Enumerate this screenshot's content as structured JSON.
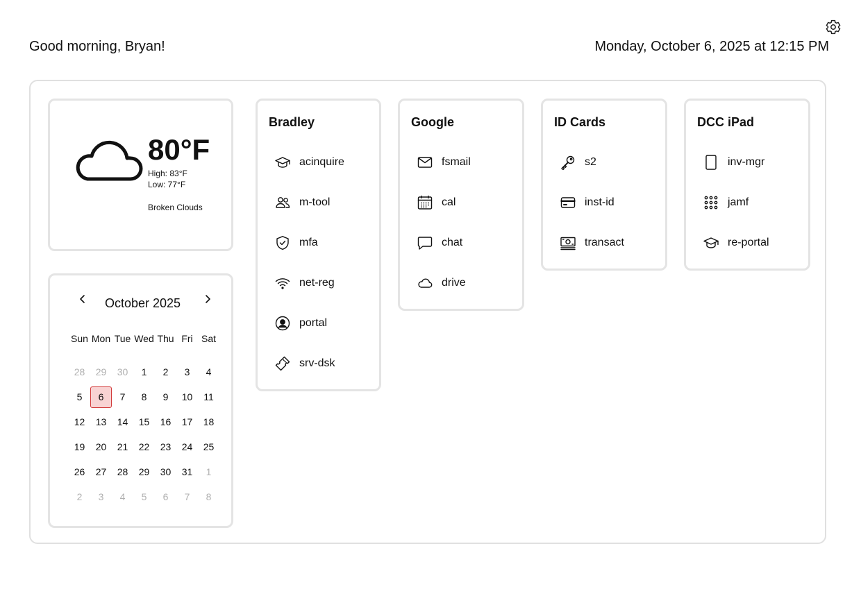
{
  "header": {
    "greeting": "Good morning, Bryan!",
    "datetime": "Monday, October 6, 2025 at 12:15 PM",
    "settings_icon": "gear-icon"
  },
  "weather": {
    "icon": "cloud-icon",
    "temperature": "80°F",
    "high": "High: 83°F",
    "low": "Low: 77°F",
    "description": "Broken Clouds"
  },
  "calendar": {
    "month_label": "October 2025",
    "prev_icon": "chevron-left-icon",
    "next_icon": "chevron-right-icon",
    "weekdays": [
      "Sun",
      "Mon",
      "Tue",
      "Wed",
      "Thu",
      "Fri",
      "Sat"
    ],
    "weeks": [
      [
        "28",
        "29",
        "30",
        "1",
        "2",
        "3",
        "4"
      ],
      [
        "5",
        "6",
        "7",
        "8",
        "9",
        "10",
        "11"
      ],
      [
        "12",
        "13",
        "14",
        "15",
        "16",
        "17",
        "18"
      ],
      [
        "19",
        "20",
        "21",
        "22",
        "23",
        "24",
        "25"
      ],
      [
        "26",
        "27",
        "28",
        "29",
        "30",
        "31",
        "1"
      ],
      [
        "2",
        "3",
        "4",
        "5",
        "6",
        "7",
        "8"
      ]
    ],
    "selected_day": "6",
    "highlight_color": "#f8d3d3",
    "highlight_border": "#d23a3a"
  },
  "groups": [
    {
      "title": "Bradley",
      "links": [
        {
          "label": "acinquire",
          "icon": "graduation-cap-icon"
        },
        {
          "label": "m-tool",
          "icon": "users-icon"
        },
        {
          "label": "mfa",
          "icon": "shield-check-icon"
        },
        {
          "label": "net-reg",
          "icon": "wifi-icon"
        },
        {
          "label": "portal",
          "icon": "user-circle-icon"
        },
        {
          "label": "srv-dsk",
          "icon": "ticket-icon"
        }
      ]
    },
    {
      "title": "Google",
      "links": [
        {
          "label": "fsmail",
          "icon": "mail-icon"
        },
        {
          "label": "cal",
          "icon": "calendar-icon"
        },
        {
          "label": "chat",
          "icon": "chat-bubble-icon"
        },
        {
          "label": "drive",
          "icon": "cloud-icon"
        }
      ]
    },
    {
      "title": "ID Cards",
      "links": [
        {
          "label": "s2",
          "icon": "key-icon"
        },
        {
          "label": "inst-id",
          "icon": "credit-card-icon"
        },
        {
          "label": "transact",
          "icon": "banknotes-icon"
        }
      ]
    },
    {
      "title": "DCC iPad",
      "links": [
        {
          "label": "inv-mgr",
          "icon": "tablet-icon"
        },
        {
          "label": "jamf",
          "icon": "grid-dots-icon"
        },
        {
          "label": "re-portal",
          "icon": "graduation-cap-icon"
        }
      ]
    }
  ]
}
